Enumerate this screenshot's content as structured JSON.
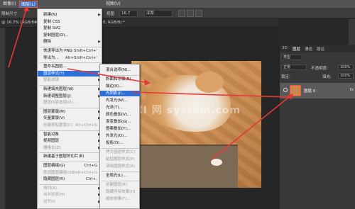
{
  "menubar": {
    "items": [
      {
        "label": "图像(I)"
      },
      {
        "label": "图层(L)"
      },
      {
        "label": "视图(V)"
      }
    ]
  },
  "options": {
    "left_text": "限制尺寸",
    "field1": "16.7",
    "mode_value": "浑厚",
    "extra_text": "视图"
  },
  "tab": {
    "text": "@ 16.7% (RGB/8#)",
    "label2": "0, RGB/8) *"
  },
  "layer_menu": {
    "items": [
      {
        "label": "新建(N)",
        "arrow": "▶",
        "state": "normal"
      },
      {
        "label": "复制 CSS",
        "state": "normal"
      },
      {
        "label": "复制 SVG",
        "state": "normal"
      },
      {
        "label": "复制图层(D)...",
        "state": "normal"
      },
      {
        "label": "删除",
        "arrow": "▶",
        "state": "normal"
      },
      {
        "label": "快速导出为 PNG",
        "shortcut": "Shift+Ctrl+'",
        "state": "normal"
      },
      {
        "label": "导出为...",
        "shortcut": "Alt+Shift+Ctrl+'",
        "state": "normal"
      },
      {
        "label": "重命名图层...",
        "state": "normal"
      },
      {
        "label": "图层样式(Y)",
        "arrow": "▶",
        "state": "highlight"
      },
      {
        "label": "智能滤镜",
        "arrow": "▶",
        "state": "disabled"
      },
      {
        "label": "新建填充图层(W)",
        "arrow": "▶",
        "state": "normal"
      },
      {
        "label": "新建调整图层(J)",
        "arrow": "▶",
        "state": "normal"
      },
      {
        "label": "图层内容选项(O)...",
        "state": "disabled"
      },
      {
        "label": "图层蒙版(M)",
        "arrow": "▶",
        "state": "normal"
      },
      {
        "label": "矢量蒙版(V)",
        "arrow": "▶",
        "state": "normal"
      },
      {
        "label": "创建剪贴蒙版(C)",
        "shortcut": "Alt+Ctrl+G",
        "state": "disabled"
      },
      {
        "label": "智能对象",
        "arrow": "▶",
        "state": "normal"
      },
      {
        "label": "视频图层",
        "arrow": "▶",
        "state": "normal"
      },
      {
        "label": "栅格化(Z)",
        "arrow": "▶",
        "state": "disabled"
      },
      {
        "label": "新建基于图层的切片(B)",
        "state": "normal"
      },
      {
        "label": "图层编组(G)",
        "shortcut": "Ctrl+G",
        "state": "normal"
      },
      {
        "label": "取消图层编组(U)",
        "shortcut": "Shift+Ctrl+G",
        "state": "disabled"
      },
      {
        "label": "隐藏图层(R)",
        "shortcut": "Ctrl+,",
        "state": "normal"
      },
      {
        "label": "排列(A)",
        "arrow": "▶",
        "state": "disabled"
      },
      {
        "label": "合并形状(H)",
        "arrow": "▶",
        "state": "disabled"
      },
      {
        "label": "对齐(I)",
        "arrow": "▶",
        "state": "disabled"
      }
    ]
  },
  "style_menu": {
    "items": [
      {
        "label": "混合选项(N)...",
        "state": "normal"
      },
      {
        "label": "斜面和浮雕(B)...",
        "state": "normal"
      },
      {
        "label": "描边(K)...",
        "state": "normal"
      },
      {
        "label": "内阴影(I)...",
        "state": "highlight"
      },
      {
        "label": "内发光(W)...",
        "state": "normal"
      },
      {
        "label": "光泽(T)...",
        "state": "normal"
      },
      {
        "label": "颜色叠加(V)...",
        "state": "normal"
      },
      {
        "label": "渐变叠加(G)...",
        "state": "normal"
      },
      {
        "label": "图案叠加(Y)...",
        "state": "normal"
      },
      {
        "label": "外发光(O)...",
        "state": "normal"
      },
      {
        "label": "投影(D)...",
        "state": "normal"
      },
      {
        "label": "拷贝图层样式(C)",
        "state": "disabled"
      },
      {
        "label": "粘贴图层样式(P)",
        "state": "disabled"
      },
      {
        "label": "清除图层样式(A)",
        "state": "disabled"
      },
      {
        "label": "全局光(L)...",
        "state": "normal"
      },
      {
        "label": "创建图层(R)",
        "state": "disabled"
      },
      {
        "label": "隐藏所有效果(H)",
        "state": "disabled"
      },
      {
        "label": "缩放效果(F)...",
        "state": "disabled"
      }
    ]
  },
  "layers_panel": {
    "tabs": [
      "3D",
      "图层",
      "通道",
      "路径"
    ],
    "kind_label": "类型",
    "blend_mode": "正常",
    "opacity_label": "不透明度:",
    "opacity_value": "100%",
    "lock_label": "锁定:",
    "fill_label": "填充:",
    "fill_value": "100%",
    "layer_name": "图层 0",
    "fx_icon": "fx"
  },
  "watermark": "XI 网 system.com",
  "colors": {
    "highlight": "#2f6fd8",
    "annotation": "#e53935"
  }
}
